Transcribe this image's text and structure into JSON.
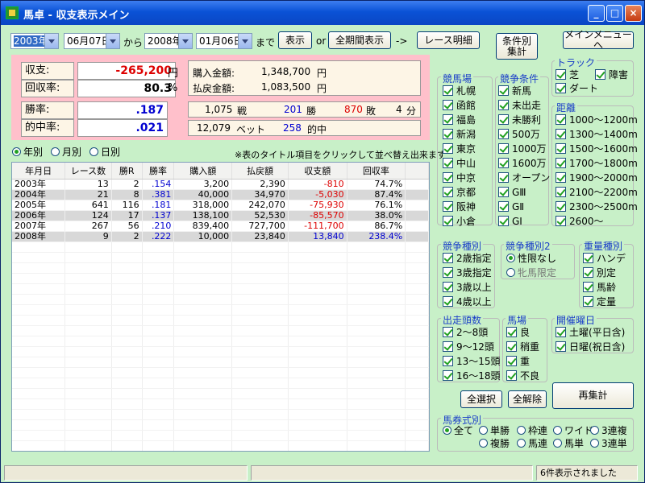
{
  "window": {
    "title": "馬卓 - 収支表示メイン",
    "min": "_",
    "max": "□",
    "close": "×"
  },
  "toolbar": {
    "from_year": "2003年",
    "from_date": "06月07日",
    "from_label": "から",
    "to_year": "2008年",
    "to_date": "01月06日",
    "to_label": "まで",
    "show_btn": "表示",
    "or_label": "or",
    "all_btn": "全期間表示",
    "arrow": "->",
    "race_detail_btn": "レース明細",
    "cond_btn_line1": "条件別",
    "cond_btn_line2": "集計",
    "main_menu_btn": "メインメニューへ"
  },
  "summary": {
    "balance_label": "収支:",
    "balance_value": "-265,200",
    "balance_unit": "円",
    "recovery_label": "回収率:",
    "recovery_value": "80.3",
    "recovery_unit": "%",
    "win_rate_label": "勝率:",
    "win_rate_value": ".187",
    "hit_rate_label": "的中率:",
    "hit_rate_value": ".021",
    "purchase_label": "購入金額:",
    "purchase_value": "1,348,700",
    "purchase_unit": "円",
    "payout_label": "払戻金額:",
    "payout_value": "1,083,500",
    "payout_unit": "円",
    "races": "1,075",
    "races_unit": "戦",
    "wins": "201",
    "wins_unit": "勝",
    "losses": "870",
    "losses_unit": "敗",
    "draws": "4",
    "draws_unit": "分",
    "bets": "12,079",
    "bets_unit": "ベット",
    "hits": "258",
    "hits_unit": "的中"
  },
  "view": {
    "yearly": "年別",
    "monthly": "月別",
    "daily": "日別",
    "hint": "※表のタイトル項目をクリックして並べ替え出来ます"
  },
  "table": {
    "headers": [
      "年月日",
      "レース数",
      "勝R",
      "勝率",
      "購入額",
      "払戻額",
      "収支額",
      "回収率"
    ],
    "rows": [
      [
        "2003年",
        "13",
        "2",
        ".154",
        "3,200",
        "2,390",
        "-810",
        "74.7%"
      ],
      [
        "2004年",
        "21",
        "8",
        ".381",
        "40,000",
        "34,970",
        "-5,030",
        "87.4%"
      ],
      [
        "2005年",
        "641",
        "116",
        ".181",
        "318,000",
        "242,070",
        "-75,930",
        "76.1%"
      ],
      [
        "2006年",
        "124",
        "17",
        ".137",
        "138,100",
        "52,530",
        "-85,570",
        "38.0%"
      ],
      [
        "2007年",
        "267",
        "56",
        ".210",
        "839,400",
        "727,700",
        "-111,700",
        "86.7%"
      ],
      [
        "2008年",
        "9",
        "2",
        ".222",
        "10,000",
        "23,840",
        "13,840",
        "238.4%"
      ]
    ]
  },
  "filters": {
    "venue_title": "競馬場",
    "venues": [
      "札幌",
      "函館",
      "福島",
      "新潟",
      "東京",
      "中山",
      "中京",
      "京都",
      "阪神",
      "小倉"
    ],
    "cond_title": "競争条件",
    "conds": [
      "新馬",
      "未出走",
      "未勝利",
      "500万",
      "1000万",
      "1600万",
      "オープン",
      "GⅢ",
      "GⅡ",
      "GⅠ"
    ],
    "track_title": "トラック",
    "track_turf": "芝",
    "track_obstacle": "障害",
    "track_dirt": "ダート",
    "dist_title": "距離",
    "dists": [
      "1000～1200m",
      "1300～1400m",
      "1500～1600m",
      "1700～1800m",
      "1900～2000m",
      "2100～2200m",
      "2300～2500m",
      "2600～"
    ],
    "type_title": "競争種別",
    "types": [
      "2歳指定",
      "3歳指定",
      "3歳以上",
      "4歳以上"
    ],
    "type2_title": "競争種別2",
    "type2_a": "性限なし",
    "type2_b": "牝馬限定",
    "weight_title": "重量種別",
    "weights": [
      "ハンデ",
      "別定",
      "馬齢",
      "定量"
    ],
    "runners_title": "出走頭数",
    "runners": [
      "2～8頭",
      "9～12頭",
      "13～15頭",
      "16～18頭"
    ],
    "ground_title": "馬場",
    "grounds": [
      "良",
      "稍重",
      "重",
      "不良"
    ],
    "day_title": "開催曜日",
    "days": [
      "土曜(平日含)",
      "日曜(祝日含)"
    ],
    "select_all": "全選択",
    "clear_all": "全解除",
    "recalc": "再集計",
    "bet_title": "馬券式別",
    "bets": [
      "全て",
      "単勝",
      "枠連",
      "ワイド",
      "3連複",
      "複勝",
      "馬連",
      "馬単",
      "3連単"
    ]
  },
  "status": {
    "message": "6件表示されました"
  }
}
